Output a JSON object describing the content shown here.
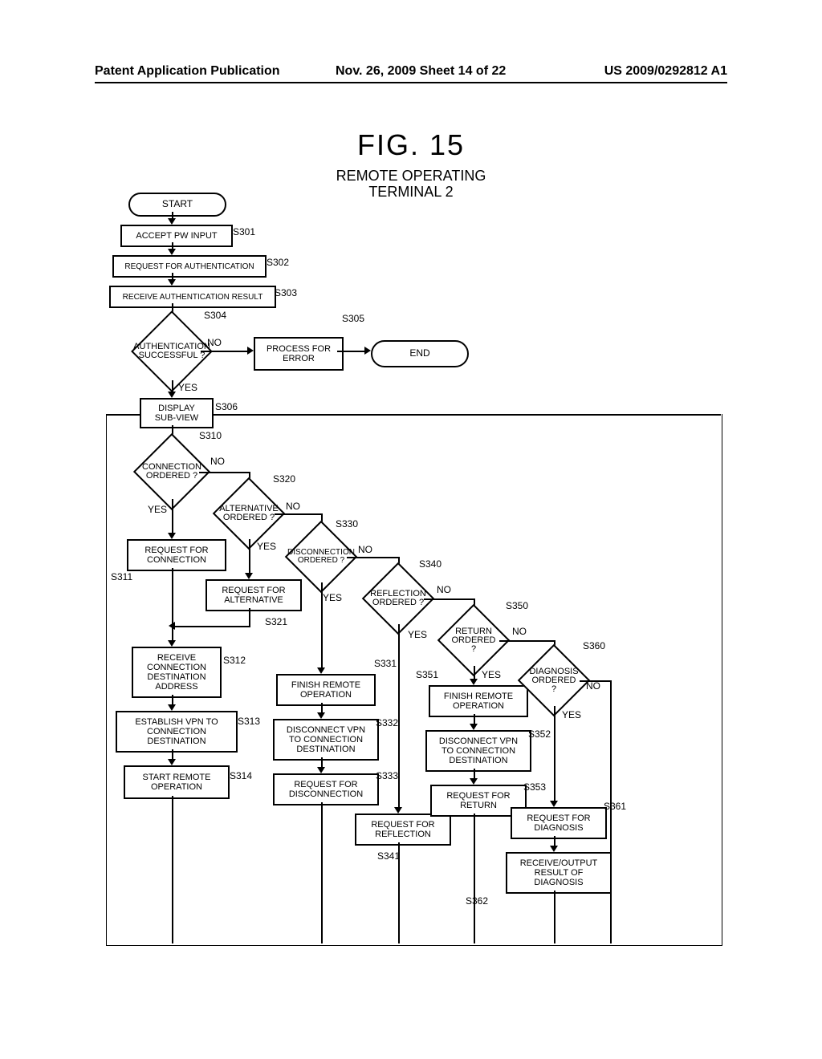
{
  "header": {
    "left": "Patent Application Publication",
    "mid": "Nov. 26, 2009  Sheet 14 of 22",
    "right": "US 2009/0292812 A1"
  },
  "figure": {
    "title": "FIG. 15",
    "subtitle": "REMOTE OPERATING\nTERMINAL 2"
  },
  "start": "START",
  "end": "END",
  "steps": {
    "s301": {
      "tag": "S301",
      "label": "ACCEPT PW INPUT"
    },
    "s302": {
      "tag": "S302",
      "label": "REQUEST FOR AUTHENTICATION"
    },
    "s303": {
      "tag": "S303",
      "label": "RECEIVE AUTHENTICATION RESULT"
    },
    "s304": {
      "tag": "S304",
      "label": "AUTHENTICATION\nSUCCESSFUL ?"
    },
    "s305": {
      "tag": "S305",
      "label": "PROCESS FOR\nERROR"
    },
    "s306": {
      "tag": "S306",
      "label": "DISPLAY\nSUB-VIEW"
    },
    "s310": {
      "tag": "S310",
      "label": "CONNECTION\nORDERED ?"
    },
    "s311": {
      "tag": "S311",
      "label": "REQUEST FOR\nCONNECTION"
    },
    "s312": {
      "tag": "S312",
      "label": "RECEIVE\nCONNECTION\nDESTINATION\nADDRESS"
    },
    "s313": {
      "tag": "S313",
      "label": "ESTABLISH VPN TO\nCONNECTION\nDESTINATION"
    },
    "s314": {
      "tag": "S314",
      "label": "START REMOTE\nOPERATION"
    },
    "s320": {
      "tag": "S320",
      "label": "ALTERNATIVE\nORDERED ?"
    },
    "s321": {
      "tag": "S321",
      "label": "REQUEST FOR\nALTERNATIVE"
    },
    "s330": {
      "tag": "S330",
      "label": "DISCONNECTION\nORDERED ?"
    },
    "s331": {
      "tag": "S331",
      "label": "FINISH REMOTE\nOPERATION"
    },
    "s332": {
      "tag": "S332",
      "label": "DISCONNECT VPN\nTO CONNECTION\nDESTINATION"
    },
    "s333": {
      "tag": "S333",
      "label": "REQUEST FOR\nDISCONNECTION"
    },
    "s340": {
      "tag": "S340",
      "label": "REFLECTION\nORDERED ?"
    },
    "s341": {
      "tag": "S341",
      "label": "REQUEST FOR\nREFLECTION"
    },
    "s350": {
      "tag": "S350",
      "label": "RETURN\nORDERED ?"
    },
    "s351": {
      "tag": "S351",
      "label": "FINISH REMOTE\nOPERATION"
    },
    "s352": {
      "tag": "S352",
      "label": "DISCONNECT VPN\nTO CONNECTION\nDESTINATION"
    },
    "s353": {
      "tag": "S353",
      "label": "REQUEST FOR\nRETURN"
    },
    "s360": {
      "tag": "S360",
      "label": "DIAGNOSIS\nORDERED ?"
    },
    "s361": {
      "tag": "S361",
      "label": "REQUEST FOR\nDIAGNOSIS"
    },
    "s362": {
      "tag": "S362",
      "label": "RECEIVE/OUTPUT\nRESULT OF\nDIAGNOSIS"
    }
  },
  "branches": {
    "yes": "YES",
    "no": "NO"
  }
}
